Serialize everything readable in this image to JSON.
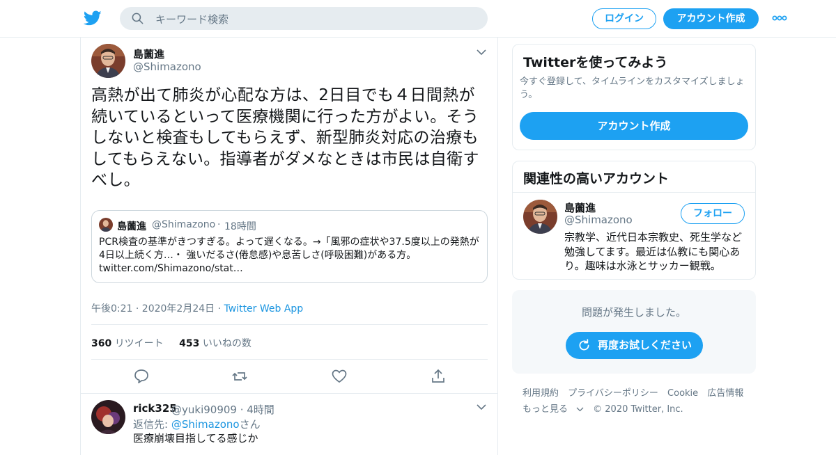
{
  "header": {
    "search_placeholder": "キーワード検索",
    "login": "ログイン",
    "signup": "アカウント作成",
    "brand_color": "#1da1f2",
    "icons": [
      "twitter-bird-icon",
      "search-icon",
      "more-dots-icon"
    ]
  },
  "tweet": {
    "name": "島薗進",
    "handle": "@Shimazono",
    "text": "高熱が出て肺炎が心配な方は、2日目でも４日間熱が続いているといって医療機関に行った方がよい。そうしないと検査もしてもらえず、新型肺炎対応の治療もしてもらえない。指導者がダメなときは市民は自衛すべし。",
    "quote": {
      "name": "島薗進",
      "handle": "@Shimazono",
      "dot": "·",
      "time": "18時間",
      "text": "PCR検査の基準がきつすぎる。よって遅くなる。→「風邪の症状や37.5度以上の発熱が4日以上続く方…・ 強いだるさ(倦怠感)や息苦しさ(呼吸困難)がある方。 twitter.com/Shimazono/stat…"
    },
    "timestamp": "午後0:21 · 2020年2月24日 · ",
    "app": "Twitter Web App",
    "retweets_count": "360",
    "retweets_label": "リツイート",
    "likes_count": "453",
    "likes_label": "いいねの数"
  },
  "reply": {
    "name": "rick325",
    "handle": "@yuki90909 · 4時間",
    "reply_prefix": "返信先: ",
    "reply_to": "@Shimazono",
    "reply_suffix": "さん",
    "text": "医療崩壊目指してる感じか"
  },
  "sidebar": {
    "signup_card": {
      "title": "Twitterを使ってみよう",
      "desc": "今すぐ登録して、タイムラインをカスタマイズしましょう。",
      "button": "アカウント作成"
    },
    "related": {
      "title": "関連性の高いアカウント",
      "name": "島薗進",
      "handle": "@Shimazono",
      "follow": "フォロー",
      "bio": "宗教学、近代日本宗教史、死生学など勉強してます。最近は仏教にも関心あり。趣味は水泳とサッカー観戦。"
    },
    "error": {
      "message": "問題が発生しました。",
      "retry": "再度お試しください"
    },
    "footer": {
      "terms": "利用規約",
      "privacy": "プライバシーポリシー",
      "cookie": "Cookie",
      "ads": "広告情報",
      "more": "もっと見る",
      "copyright": "© 2020 Twitter, Inc."
    }
  }
}
